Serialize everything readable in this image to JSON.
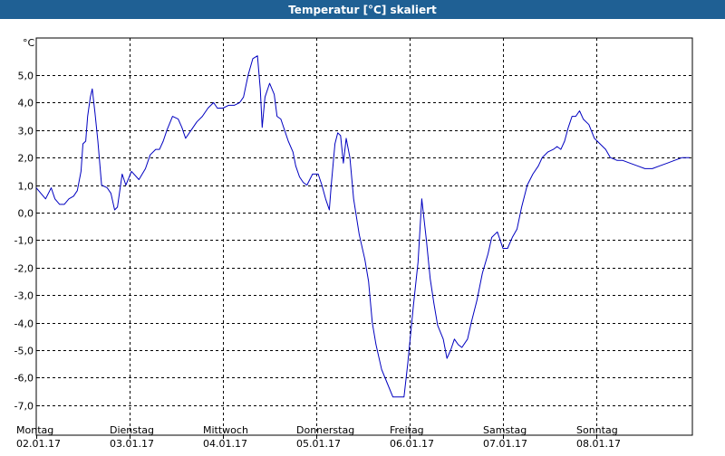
{
  "window": {
    "title": "Temperatur [°C] skaliert"
  },
  "chart_data": {
    "type": "line",
    "title": "Temperatur [°C] skaliert",
    "ylabel": "°C",
    "xlabel": "",
    "ylim": [
      -7.4,
      6.3
    ],
    "xlim": [
      0,
      7
    ],
    "grid": true,
    "y_ticks": [
      5,
      4,
      3,
      2,
      1,
      0,
      -1,
      -2,
      -3,
      -4,
      -5,
      -6,
      -7
    ],
    "y_tick_labels": [
      "5,0",
      "4,0",
      "3,0",
      "2,0",
      "1,0",
      "0,0",
      "-1,0",
      "-2,0",
      "-3,0",
      "-4,0",
      "-5,0",
      "-6,0",
      "-7,0"
    ],
    "x_ticks": [
      {
        "day": "Montag",
        "date": "02.01.17"
      },
      {
        "day": "Dienstag",
        "date": "03.01.17"
      },
      {
        "day": "Mittwoch",
        "date": "04.01.17"
      },
      {
        "day": "Donnerstag",
        "date": "05.01.17"
      },
      {
        "day": "Freitag",
        "date": "06.01.17"
      },
      {
        "day": "Samstag",
        "date": "07.01.17"
      },
      {
        "day": "Sonntag",
        "date": "08.01.17"
      }
    ],
    "series": [
      {
        "color": "#0000c0",
        "points": [
          [
            0.0,
            0.9
          ],
          [
            0.05,
            0.7
          ],
          [
            0.1,
            0.5
          ],
          [
            0.16,
            0.9
          ],
          [
            0.2,
            0.5
          ],
          [
            0.25,
            0.3
          ],
          [
            0.3,
            0.3
          ],
          [
            0.35,
            0.5
          ],
          [
            0.4,
            0.6
          ],
          [
            0.44,
            0.8
          ],
          [
            0.48,
            1.5
          ],
          [
            0.5,
            2.5
          ],
          [
            0.53,
            2.6
          ],
          [
            0.55,
            3.5
          ],
          [
            0.58,
            4.2
          ],
          [
            0.6,
            4.5
          ],
          [
            0.63,
            3.6
          ],
          [
            0.66,
            2.6
          ],
          [
            0.7,
            1.0
          ],
          [
            0.76,
            0.9
          ],
          [
            0.8,
            0.7
          ],
          [
            0.84,
            0.1
          ],
          [
            0.87,
            0.2
          ],
          [
            0.92,
            1.4
          ],
          [
            0.96,
            1.0
          ],
          [
            1.02,
            1.5
          ],
          [
            1.1,
            1.2
          ],
          [
            1.17,
            1.6
          ],
          [
            1.22,
            2.1
          ],
          [
            1.28,
            2.3
          ],
          [
            1.32,
            2.3
          ],
          [
            1.36,
            2.6
          ],
          [
            1.4,
            3.0
          ],
          [
            1.46,
            3.5
          ],
          [
            1.52,
            3.4
          ],
          [
            1.56,
            3.1
          ],
          [
            1.6,
            2.7
          ],
          [
            1.66,
            3.0
          ],
          [
            1.72,
            3.3
          ],
          [
            1.78,
            3.5
          ],
          [
            1.84,
            3.8
          ],
          [
            1.9,
            4.0
          ],
          [
            1.94,
            3.8
          ],
          [
            2.0,
            3.8
          ],
          [
            2.06,
            3.9
          ],
          [
            2.12,
            3.9
          ],
          [
            2.18,
            4.0
          ],
          [
            2.22,
            4.2
          ],
          [
            2.27,
            5.0
          ],
          [
            2.32,
            5.6
          ],
          [
            2.37,
            5.7
          ],
          [
            2.4,
            4.5
          ],
          [
            2.42,
            3.1
          ],
          [
            2.45,
            4.2
          ],
          [
            2.5,
            4.7
          ],
          [
            2.55,
            4.3
          ],
          [
            2.58,
            3.5
          ],
          [
            2.62,
            3.4
          ],
          [
            2.66,
            3.0
          ],
          [
            2.7,
            2.6
          ],
          [
            2.75,
            2.2
          ],
          [
            2.78,
            1.7
          ],
          [
            2.82,
            1.3
          ],
          [
            2.86,
            1.1
          ],
          [
            2.9,
            1.0
          ],
          [
            2.96,
            1.4
          ],
          [
            3.02,
            1.4
          ],
          [
            3.06,
            1.0
          ],
          [
            3.1,
            0.5
          ],
          [
            3.14,
            0.1
          ],
          [
            3.16,
            1.0
          ],
          [
            3.2,
            2.5
          ],
          [
            3.23,
            2.9
          ],
          [
            3.26,
            2.8
          ],
          [
            3.29,
            1.8
          ],
          [
            3.32,
            2.7
          ],
          [
            3.36,
            2.0
          ],
          [
            3.4,
            0.5
          ],
          [
            3.46,
            -0.8
          ],
          [
            3.52,
            -1.7
          ],
          [
            3.56,
            -2.5
          ],
          [
            3.6,
            -4.0
          ],
          [
            3.64,
            -4.8
          ],
          [
            3.7,
            -5.7
          ],
          [
            3.76,
            -6.2
          ],
          [
            3.82,
            -6.7
          ],
          [
            3.88,
            -6.7
          ],
          [
            3.94,
            -6.7
          ],
          [
            3.98,
            -5.5
          ],
          [
            4.04,
            -3.4
          ],
          [
            4.09,
            -1.8
          ],
          [
            4.13,
            0.5
          ],
          [
            4.18,
            -1.0
          ],
          [
            4.22,
            -2.4
          ],
          [
            4.26,
            -3.3
          ],
          [
            4.3,
            -4.1
          ],
          [
            4.36,
            -4.6
          ],
          [
            4.4,
            -5.3
          ],
          [
            4.44,
            -5.0
          ],
          [
            4.48,
            -4.6
          ],
          [
            4.52,
            -4.8
          ],
          [
            4.56,
            -4.9
          ],
          [
            4.62,
            -4.6
          ],
          [
            4.66,
            -4.0
          ],
          [
            4.72,
            -3.2
          ],
          [
            4.78,
            -2.2
          ],
          [
            4.84,
            -1.5
          ],
          [
            4.88,
            -0.9
          ],
          [
            4.94,
            -0.7
          ],
          [
            5.0,
            -1.3
          ],
          [
            5.05,
            -1.3
          ],
          [
            5.1,
            -0.9
          ],
          [
            5.15,
            -0.6
          ],
          [
            5.2,
            0.2
          ],
          [
            5.26,
            1.0
          ],
          [
            5.32,
            1.4
          ],
          [
            5.38,
            1.7
          ],
          [
            5.42,
            2.0
          ],
          [
            5.48,
            2.2
          ],
          [
            5.54,
            2.3
          ],
          [
            5.58,
            2.4
          ],
          [
            5.62,
            2.3
          ],
          [
            5.66,
            2.6
          ],
          [
            5.7,
            3.1
          ],
          [
            5.74,
            3.5
          ],
          [
            5.78,
            3.5
          ],
          [
            5.82,
            3.7
          ],
          [
            5.86,
            3.4
          ],
          [
            5.92,
            3.2
          ],
          [
            5.98,
            2.7
          ],
          [
            6.04,
            2.5
          ],
          [
            6.1,
            2.3
          ],
          [
            6.15,
            2.0
          ],
          [
            6.22,
            1.9
          ],
          [
            6.28,
            1.9
          ],
          [
            6.36,
            1.8
          ],
          [
            6.44,
            1.7
          ],
          [
            6.52,
            1.6
          ],
          [
            6.6,
            1.6
          ],
          [
            6.68,
            1.7
          ],
          [
            6.76,
            1.8
          ],
          [
            6.84,
            1.9
          ],
          [
            6.92,
            2.0
          ],
          [
            7.0,
            2.0
          ]
        ]
      }
    ]
  }
}
